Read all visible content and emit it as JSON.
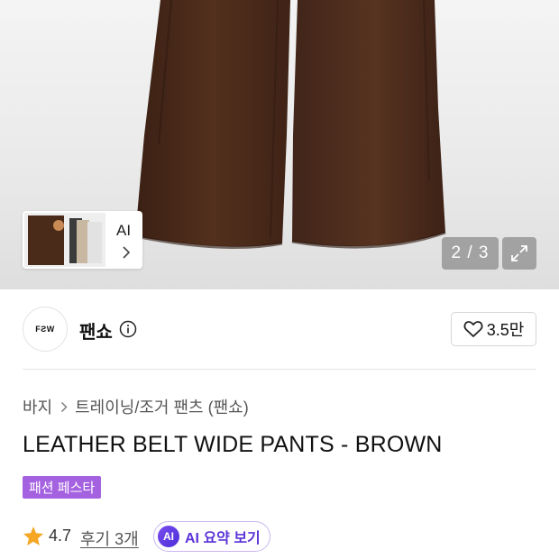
{
  "gallery": {
    "thumbnail_ai_label": "AI",
    "pager_text": "2 / 3"
  },
  "brand": {
    "logo_text": "FƧW",
    "name": "팬쇼",
    "like_count": "3.5만"
  },
  "breadcrumb": {
    "items": [
      "바지",
      "트레이닝/조거 팬츠 (팬쇼)"
    ]
  },
  "product": {
    "title": "LEATHER BELT WIDE PANTS - BROWN",
    "badge": "패션 페스타"
  },
  "rating": {
    "score": "4.7",
    "reviews": "후기 3개",
    "ai_icon": "AI",
    "ai_summary_label": "AI 요약 보기"
  },
  "colors": {
    "badge": "#a562e0",
    "ai_accent": "#5b33d8",
    "star": "#f5a623",
    "pants": "#4a2a18"
  }
}
